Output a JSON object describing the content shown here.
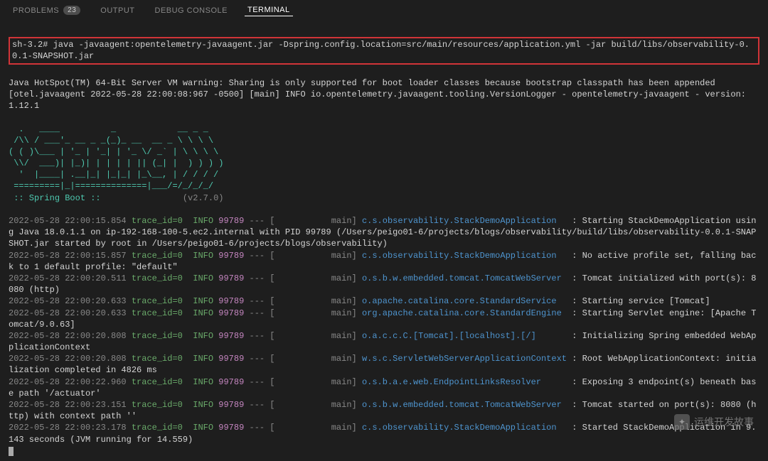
{
  "tabs": {
    "problems": "PROBLEMS",
    "problems_count": "23",
    "output": "OUTPUT",
    "debug_console": "DEBUG CONSOLE",
    "terminal": "TERMINAL"
  },
  "cmd": {
    "prompt": "sh-3.2# ",
    "line": "java -javaagent:opentelemetry-javaagent.jar -Dspring.config.location=src/main/resources/application.yml -jar build/libs/observability-0.0.1-SNAPSHOT.jar"
  },
  "hotspot": "Java HotSpot(TM) 64-Bit Server VM warning: Sharing is only supported for boot loader classes because bootstrap classpath has been appended",
  "agent": "[otel.javaagent 2022-05-28 22:00:08:967 -0500] [main] INFO io.opentelemetry.javaagent.tooling.VersionLogger - opentelemetry-javaagent - version: 1.12.1",
  "banner": {
    "l1": "  .   ____          _            __ _ _",
    "l2": " /\\\\ / ___'_ __ _ _(_)_ __  __ _ \\ \\ \\ \\",
    "l3": "( ( )\\___ | '_ | '_| | '_ \\/ _` | \\ \\ \\ \\",
    "l4": " \\\\/  ___)| |_)| | | | | || (_| |  ) ) ) )",
    "l5": "  '  |____| .__|_| |_|_| |_\\__, | / / / /",
    "l6": " =========|_|==============|___/=/_/_/_/"
  },
  "boot": {
    "label": " :: Spring Boot :: ",
    "spacer": "               ",
    "ver": "(v2.7.0)"
  },
  "trace": "trace_id=0",
  "info": "INFO",
  "pid": "99789",
  "sep": " --- [           main] ",
  "log": [
    {
      "ts": "2022-05-28 22:00:15.854",
      "cls": "c.s.observability.StackDemoApplication  ",
      "msg": ": Starting StackDemoApplication using Java 18.0.1.1 on ip-192-168-100-5.ec2.internal with PID 99789 (/Users/peigo01-6/projects/blogs/observability/build/libs/observability-0.0.1-SNAPSHOT.jar started by root in /Users/peigo01-6/projects/blogs/observability)"
    },
    {
      "ts": "2022-05-28 22:00:15.857",
      "cls": "c.s.observability.StackDemoApplication  ",
      "msg": ": No active profile set, falling back to 1 default profile: \"default\""
    },
    {
      "ts": "2022-05-28 22:00:20.511",
      "cls": "o.s.b.w.embedded.tomcat.TomcatWebServer ",
      "msg": ": Tomcat initialized with port(s): 8080 (http)"
    },
    {
      "ts": "2022-05-28 22:00:20.633",
      "cls": "o.apache.catalina.core.StandardService  ",
      "msg": ": Starting service [Tomcat]"
    },
    {
      "ts": "2022-05-28 22:00:20.633",
      "cls": "org.apache.catalina.core.StandardEngine ",
      "msg": ": Starting Servlet engine: [Apache Tomcat/9.0.63]"
    },
    {
      "ts": "2022-05-28 22:00:20.808",
      "cls": "o.a.c.c.C.[Tomcat].[localhost].[/]      ",
      "msg": ": Initializing Spring embedded WebApplicationContext"
    },
    {
      "ts": "2022-05-28 22:00:20.808",
      "cls": "w.s.c.ServletWebServerApplicationContext",
      "msg": ": Root WebApplicationContext: initialization completed in 4826 ms"
    },
    {
      "ts": "2022-05-28 22:00:22.960",
      "cls": "o.s.b.a.e.web.EndpointLinksResolver     ",
      "msg": ": Exposing 3 endpoint(s) beneath base path '/actuator'"
    },
    {
      "ts": "2022-05-28 22:00:23.151",
      "cls": "o.s.b.w.embedded.tomcat.TomcatWebServer ",
      "msg": ": Tomcat started on port(s): 8080 (http) with context path ''"
    },
    {
      "ts": "2022-05-28 22:00:23.178",
      "cls": "c.s.observability.StackDemoApplication  ",
      "msg": ": Started StackDemoApplication in 9.143 seconds (JVM running for 14.559)"
    }
  ],
  "watermark": "运维开发故事"
}
